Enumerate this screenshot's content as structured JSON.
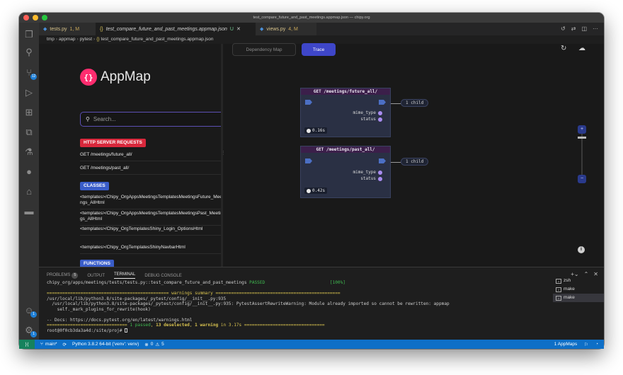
{
  "window": {
    "title": "test_compare_future_and_past_meetings.appmap.json — chipy.org"
  },
  "activity_bar": {
    "source_control_badge": "12",
    "account_badge": "1",
    "settings_badge": "1"
  },
  "tabs": [
    {
      "label": "tests.py",
      "status": "1, M"
    },
    {
      "label": "test_compare_future_and_past_meetings.appmap.json",
      "status": "U"
    },
    {
      "label": "views.py",
      "status": "4, M"
    }
  ],
  "breadcrumb": {
    "parts": [
      "tmp",
      "appmap",
      "pytest",
      "test_compare_future_and_past_meetings.appmap.json"
    ]
  },
  "appmap": {
    "logo_text": "AppMap",
    "search_placeholder": "Search...",
    "http_header": "HTTP SERVER REQUESTS",
    "http_items": [
      "GET /meetings/future_all/",
      "GET /meetings/past_all/"
    ],
    "classes_header": "CLASSES",
    "class_items": [
      "<templates>/Chipy_OrgAppsMeetingsTemplatesMeetingsFuture_Meetings_AllHtml",
      "<templates>/Chipy_OrgAppsMeetingsTemplatesMeetingsPast_Meetings_AllHtml",
      "<templates>/Chipy_OrgTemplatesShiny_Login_OptionsHtml",
      "<templates>/Chipy_OrgTemplatesShinyNavbarHtml"
    ],
    "functions_header": "FUNCTIONS",
    "function_item": "<templates>/Chipy_OrgAppsMeetingsTemplatesMeetingsF",
    "views": {
      "dependency": "Dependency Map",
      "trace": "Trace"
    },
    "zoom": {
      "in": "+",
      "out": "−"
    },
    "info": "i",
    "nodes": [
      {
        "title": "GET /meetings/future_all/",
        "fields": [
          "mime_type",
          "status"
        ],
        "time": "0.16s",
        "children": "1 child"
      },
      {
        "title": "GET /meetings/past_all/",
        "fields": [
          "mime_type",
          "status"
        ],
        "time": "0.42s",
        "children": "1 child"
      }
    ]
  },
  "panel": {
    "tabs": [
      "PROBLEMS",
      "OUTPUT",
      "TERMINAL",
      "DEBUG CONSOLE"
    ],
    "problems_count": "5",
    "active_tab": "TERMINAL",
    "terminal": {
      "line1_path": "chipy_org/apps/meetings/tests/tests.py::test_compare_future_and_past_meetings",
      "line1_status": "PASSED",
      "line1_pct": "[100%]",
      "warn_header": "=============================================== warnings summary ================================================",
      "warn1": "/usr/local/lib/python3.8/site-packages/_pytest/config/__init__.py:935",
      "warn2": "  /usr/local/lib/python3.8/site-packages/_pytest/config/__init__.py:935: PytestAssertRewriteWarning: Module already imported so cannot be rewritten: appmap",
      "warn3": "    self._mark_plugins_for_rewrite(hook)",
      "docs": "-- Docs: https://docs.pytest.org/en/latest/warnings.html",
      "sum_pre": "=============================== ",
      "sum_passed": "1 passed",
      "sum_mid1": ", ",
      "sum_desel": "13 deselected",
      "sum_mid2": ", ",
      "sum_warn": "1 warning",
      "sum_time": " in 3.17s ",
      "sum_post": "===============================",
      "prompt": "root@0f0cb3da3a4d:/site/proj# "
    },
    "shells": [
      "zsh",
      "make",
      "make"
    ]
  },
  "statusbar": {
    "branch": "main*",
    "python": "Python 3.8.2 64-bit ('venv': venv)",
    "errors": "0",
    "warnings": "5",
    "appmaps": "1 AppMaps"
  },
  "colors": {
    "accent": "#3e46c9",
    "http_tag": "#d9283c",
    "status_bar": "#0e6fc7",
    "logo": "#ff2d6f"
  }
}
